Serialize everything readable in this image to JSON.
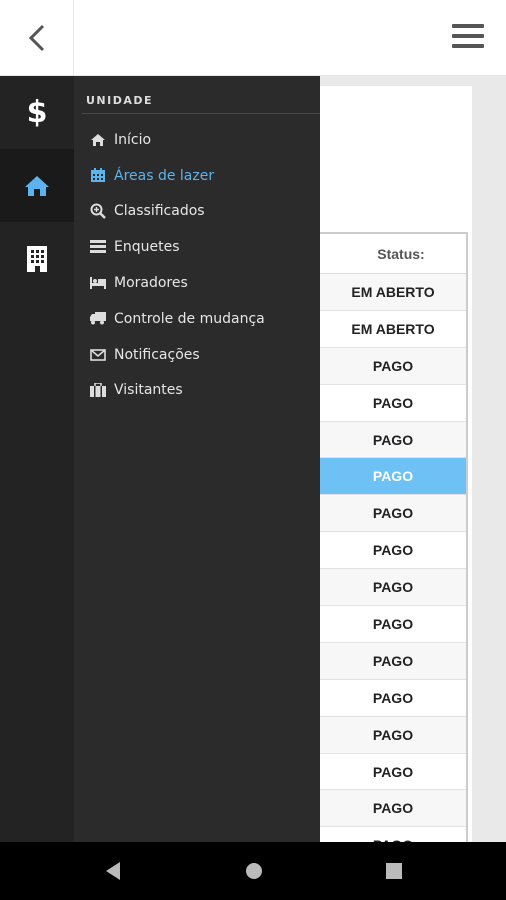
{
  "header": {
    "back_icon": "chevron-left-icon",
    "menu_icon": "hamburger-menu-icon"
  },
  "rail": {
    "items": [
      {
        "name": "finance",
        "glyph": "$",
        "icon": "dollar-icon"
      },
      {
        "name": "home",
        "icon": "home-icon"
      },
      {
        "name": "building",
        "icon": "building-icon"
      }
    ]
  },
  "drawer": {
    "section_title": "UNIDADE",
    "items": [
      {
        "label": "Início",
        "icon": "home-icon"
      },
      {
        "label": "Áreas de lazer",
        "icon": "calendar-icon",
        "active": true
      },
      {
        "label": "Classificados",
        "icon": "search-plus-icon"
      },
      {
        "label": "Enquetes",
        "icon": "tasks-icon"
      },
      {
        "label": "Moradores",
        "icon": "bed-icon"
      },
      {
        "label": "Controle de mudança",
        "icon": "truck-icon"
      },
      {
        "label": "Notificações",
        "icon": "envelope-icon"
      },
      {
        "label": "Visitantes",
        "icon": "briefcase-icon"
      }
    ]
  },
  "table": {
    "header": "Status:",
    "rows": [
      "EM ABERTO",
      "EM ABERTO",
      "PAGO",
      "PAGO",
      "PAGO",
      "PAGO",
      "PAGO",
      "PAGO",
      "PAGO",
      "PAGO",
      "PAGO",
      "PAGO",
      "PAGO",
      "PAGO",
      "PAGO",
      "PAGO"
    ],
    "selected_index": 5
  },
  "colors": {
    "accent": "#5cb3ee",
    "selected_row": "#6ec1f5",
    "drawer_bg": "#2b2b2b",
    "rail_bg": "#232323"
  }
}
